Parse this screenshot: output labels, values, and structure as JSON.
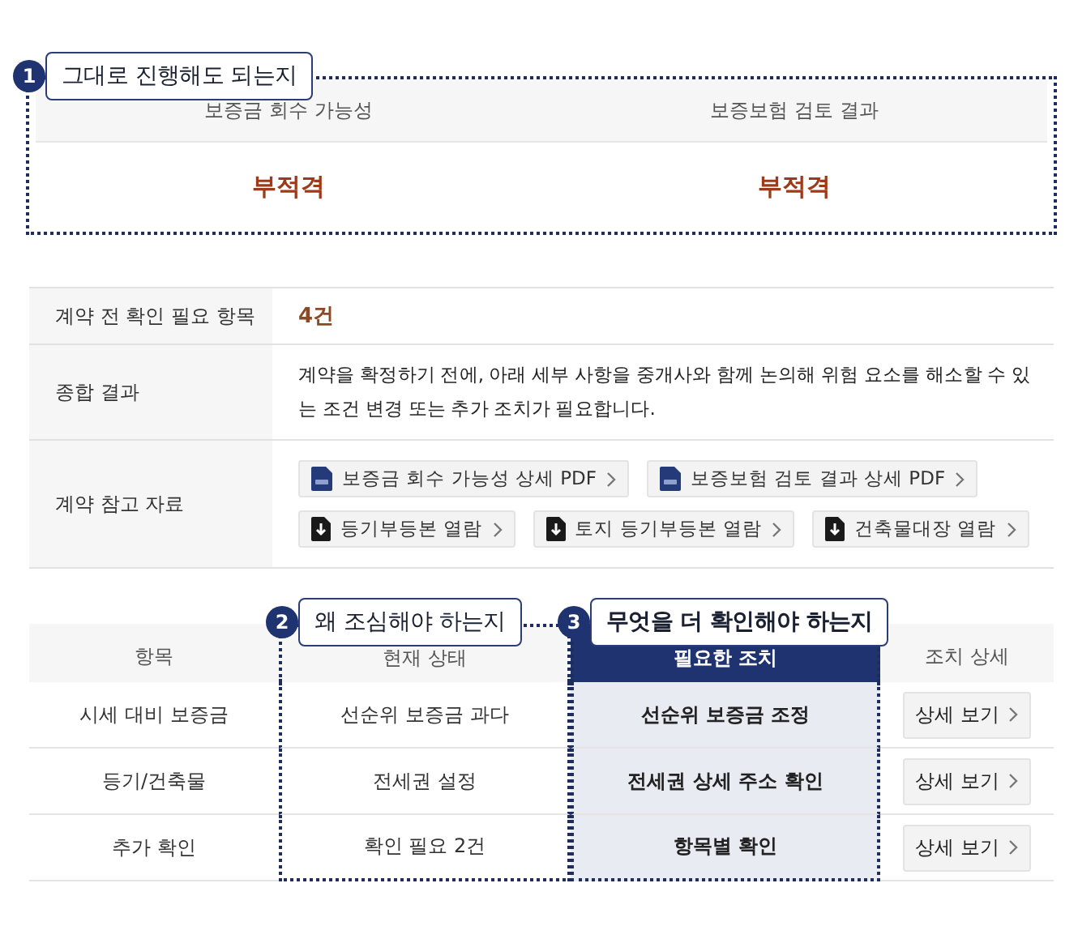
{
  "summary_box": {
    "callout": {
      "number": "1",
      "label": "그대로 진행해도 되는지"
    },
    "columns": [
      {
        "heading": "보증금 회수 가능성",
        "value": "부적격"
      },
      {
        "heading": "보증보험 검토 결과",
        "value": "부적격"
      }
    ]
  },
  "info_table": {
    "rows": [
      {
        "kind": "count",
        "label": "계약 전 확인 필요 항목",
        "value": "4건"
      },
      {
        "kind": "text",
        "label": "종합 결과",
        "value": "계약을 확정하기 전에, 아래 세부 사항을 중개사와 함께 논의해 위험 요소를 해소할 수 있는 조건 변경 또는 추가 조치가 필요합니다."
      },
      {
        "kind": "links",
        "label": "계약 참고 자료",
        "links": [
          {
            "kind": "pdf",
            "label": "보증금 회수 가능성 상세 PDF"
          },
          {
            "kind": "pdf",
            "label": "보증보험 검토 결과 상세 PDF"
          },
          {
            "kind": "download",
            "label": "등기부등본 열람"
          },
          {
            "kind": "download",
            "label": "토지 등기부등본 열람"
          },
          {
            "kind": "download",
            "label": "건축물대장 열람"
          }
        ]
      }
    ]
  },
  "action_table": {
    "columns": [
      {
        "heading": "항목",
        "highlighted": false
      },
      {
        "heading": "현재 상태",
        "highlighted": false,
        "callout": {
          "number": "2",
          "label": "왜 조심해야 하는지"
        }
      },
      {
        "heading": "필요한 조치",
        "highlighted": true,
        "callout": {
          "number": "3",
          "label": "무엇을 더 확인해야 하는지"
        }
      },
      {
        "heading": "조치 상세",
        "highlighted": false
      }
    ],
    "rows": [
      {
        "item": "시세 대비 보증금",
        "status": "선순위 보증금 과다",
        "action": "선순위 보증금 조정",
        "button": "상세 보기"
      },
      {
        "item": "등기/건축물",
        "status": "전세권 설정",
        "action": "전세권 상세 주소 확인",
        "button": "상세 보기"
      },
      {
        "item": "추가 확인",
        "status": "확인 필요 2건",
        "action": "항목별 확인",
        "button": "상세 보기"
      }
    ]
  }
}
